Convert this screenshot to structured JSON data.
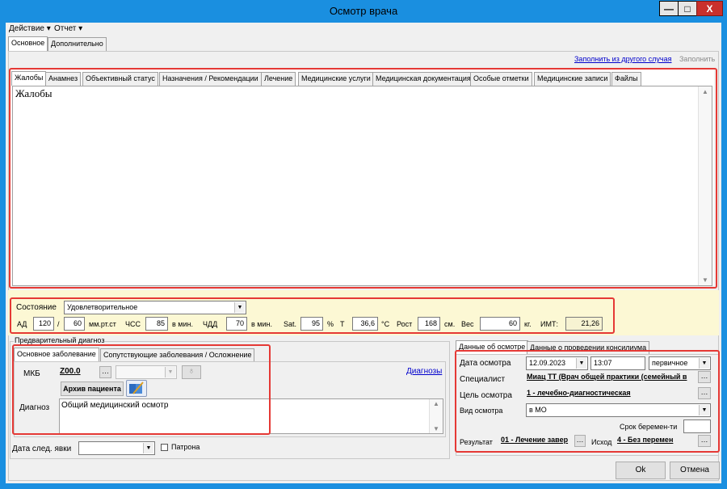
{
  "window": {
    "title": "Осмотр врача",
    "minimize": "—",
    "maximize": "□",
    "close": "X"
  },
  "menu": {
    "action": "Действие ▾",
    "report": "Отчет ▾"
  },
  "top_tabs": [
    "Основное",
    "Дополнительно"
  ],
  "links": {
    "fill_from_other": "Заполнить из другого случая",
    "fill": "Заполнить"
  },
  "section_tabs": [
    "Жалобы",
    "Анамнез",
    "Объективный статус",
    "Назначения / Рекомендации",
    "Лечение",
    "Медицинские услуги",
    "Медицинская документация",
    "Особые отметки",
    "Медицинские записи",
    "Файлы"
  ],
  "complaints_text": "Жалобы",
  "vitals": {
    "state_label": "Состояние",
    "state_value": "Удовлетворительное",
    "ad_label": "АД",
    "ad_sys": "120",
    "ad_sep": "/",
    "ad_dia": "60",
    "ad_unit": "мм.рт.ст",
    "hr_label": "ЧСС",
    "hr_value": "85",
    "hr_unit": "в мин.",
    "rr_label": "ЧДД",
    "rr_value": "70",
    "rr_unit": "в мин.",
    "sat_label": "Sat.",
    "sat_value": "95",
    "sat_unit": "%",
    "t_label": "Т",
    "t_value": "36,6",
    "t_unit": "°С",
    "height_label": "Рост",
    "height_value": "168",
    "height_unit": "см.",
    "weight_label": "Вес",
    "weight_value": "60",
    "weight_unit": "кг.",
    "bmi_label": "ИМТ:",
    "bmi_value": "21,26"
  },
  "diagnosis": {
    "group_label": "Предварительный диагноз",
    "tabs": [
      "Основное заболевание",
      "Сопутствующие заболевания / Осложнение"
    ],
    "mkb_label": "МКБ",
    "mkb_value": "Z00.0",
    "diagnoses_link": "Диагнозы",
    "archive_button": "Архив пациента",
    "diag_label": "Диагноз",
    "diag_text": "Общий медицинский осмотр"
  },
  "next_visit": {
    "label": "Дата след. явки",
    "patronage_label": "Патрона"
  },
  "exam": {
    "tabs": [
      "Данные об осмотре",
      "Данные о проведении консилиума"
    ],
    "date_label": "Дата осмотра",
    "date_value": "12.09.2023",
    "time_value": "13:07",
    "visit_type": "первичное",
    "specialist_label": "Специалист",
    "specialist_value": "Миац ТТ (Врач общей практики (семейный в",
    "goal_label": "Цель осмотра",
    "goal_value": "1 - лечебно-диагностическая",
    "kind_label": "Вид осмотра",
    "kind_value": "в МО",
    "pregnancy_label": "Срок беремен-ти",
    "result_label": "Результат",
    "result_value": "01 - Лечение завер",
    "outcome_label": "Исход",
    "outcome_value": "4 - Без перемен"
  },
  "footer": {
    "ok": "Ok",
    "cancel": "Отмена"
  },
  "colors": {
    "title_bar": "#1a8fe0",
    "highlight_box": "#e53935",
    "vitals_bg": "#fcf8d4",
    "link": "#0000cc"
  }
}
